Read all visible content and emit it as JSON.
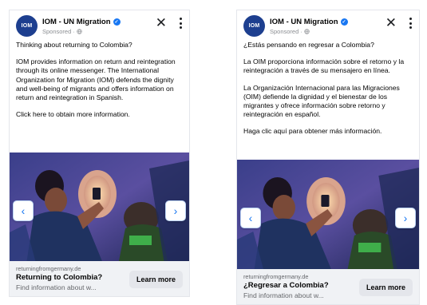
{
  "ads": [
    {
      "page_name": "IOM - UN Migration",
      "avatar_text": "IOM",
      "sponsored": "Sponsored · ",
      "paragraphs": [
        "Thinking about returning to Colombia?",
        "IOM provides information on return and reintegration through its online messenger. The International Organization for Migration (IOM) defends the dignity and well-being of migrants and offers information on return and reintegration in Spanish.",
        "Click here to obtain more information."
      ],
      "domain": "returningfromgermany.de",
      "headline": "Returning to Colombia?",
      "description": "Find information about w...",
      "cta": "Learn more"
    },
    {
      "page_name": "IOM - UN Migration",
      "avatar_text": "IOM",
      "sponsored": "Sponsored · ",
      "paragraphs": [
        "¿Estás pensando en regresar a Colombia?",
        "La OIM proporciona información sobre el retorno y la reintegración a través de su mensajero en línea.",
        "La Organización Internacional para las Migraciones (OIM) defiende la dignidad y el bienestar de los migrantes y ofrece información sobre retorno y reintegración en español.",
        "Haga clic aquí para obtener más información."
      ],
      "domain": "returningfromgermany.de",
      "headline": "¿Regresar a Colombia?",
      "description": "Find information about w...",
      "cta": "Learn more"
    }
  ],
  "icons": {
    "close": "✕",
    "prev": "‹",
    "next": "›",
    "verified": "✓"
  },
  "colors": {
    "verified": "#1877f2",
    "avatar_bg": "#1d3f8f",
    "footer_bg": "#f0f2f5",
    "cta_bg": "#e4e6eb"
  }
}
